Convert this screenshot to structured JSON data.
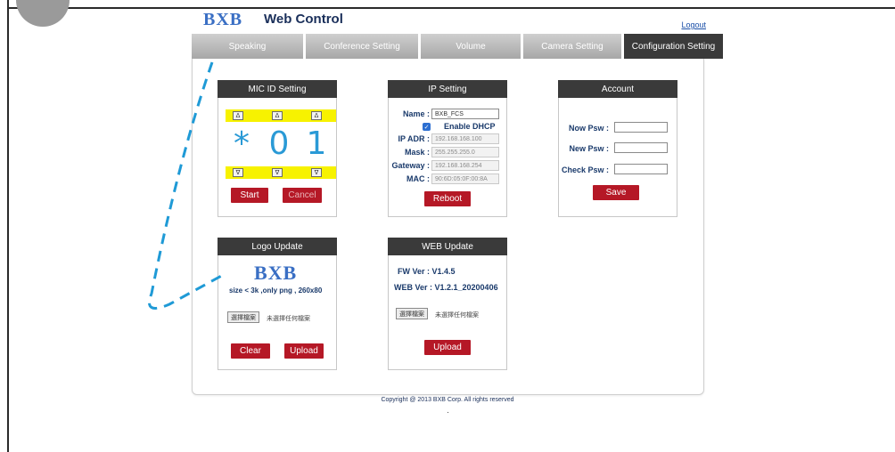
{
  "header": {
    "logo": "BXB",
    "title": "Web Control",
    "logout": "Logout"
  },
  "tabs": [
    {
      "label": "Speaking",
      "active": false
    },
    {
      "label": "Conference Setting",
      "active": false
    },
    {
      "label": "Volume",
      "active": false
    },
    {
      "label": "Camera Setting",
      "active": false
    },
    {
      "label": "Configuration Setting",
      "active": true
    }
  ],
  "mic_id": {
    "title": "MIC ID Setting",
    "up_arrow": "Δ",
    "down_arrow": "∇",
    "digits": [
      "*",
      "0",
      "1"
    ],
    "start": "Start",
    "cancel": "Cancel"
  },
  "ip_setting": {
    "title": "IP Setting",
    "name_label": "Name :",
    "name_value": "BXB_FCS",
    "dhcp_label": "Enable DHCP",
    "dhcp_checked": true,
    "ip_label": "IP ADR :",
    "ip_value": "192.168.168.100",
    "mask_label": "Mask :",
    "mask_value": "255.255.255.0",
    "gateway_label": "Gateway :",
    "gateway_value": "192.168.168.254",
    "mac_label": "MAC :",
    "mac_value": "90:6D:05:0F:00:8A",
    "reboot": "Reboot"
  },
  "account": {
    "title": "Account",
    "now_psw": "Now Psw :",
    "new_psw": "New Psw :",
    "check_psw": "Check Psw :",
    "save": "Save"
  },
  "logo_update": {
    "title": "Logo Update",
    "logo_preview": "BXB",
    "hint": "size < 3k ,only png , 260x80",
    "choose_file": "選擇檔案",
    "no_file": "未選擇任何檔案",
    "clear": "Clear",
    "upload": "Upload"
  },
  "web_update": {
    "title": "WEB Update",
    "fw_ver": "FW Ver : V1.4.5",
    "web_ver": "WEB Ver : V1.2.1_20200406",
    "choose_file": "選擇檔案",
    "no_file": "未選擇任何檔案",
    "upload": "Upload"
  },
  "footer": {
    "copyright": "Copyright @ 2013 BXB Corp. All rights reserved"
  },
  "colors": {
    "tab_active": "#3a3a3a",
    "button_red": "#b51826",
    "digit_blue": "#2a9ad6",
    "highlight_yellow": "#f7f200",
    "annotation_blue": "#1f9ad6"
  }
}
